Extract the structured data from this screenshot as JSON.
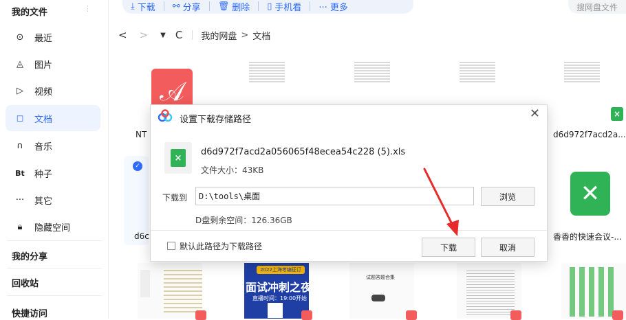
{
  "sidebar": {
    "my_files": "我的文件",
    "items": [
      {
        "icon": "clock-icon",
        "glyph": "⊙",
        "label": "最近"
      },
      {
        "icon": "image-icon",
        "glyph": "◬",
        "label": "图片"
      },
      {
        "icon": "video-icon",
        "glyph": "▷",
        "label": "视频"
      },
      {
        "icon": "document-icon",
        "glyph": "◻",
        "label": "文档"
      },
      {
        "icon": "music-icon",
        "glyph": "∩",
        "label": "音乐"
      },
      {
        "icon": "bt-icon",
        "glyph": "Bt",
        "label": "种子"
      },
      {
        "icon": "more-icon",
        "glyph": "···",
        "label": "其它"
      },
      {
        "icon": "lock-icon",
        "glyph": "🔒︎",
        "label": "隐藏空间"
      }
    ],
    "active_index": 3,
    "my_share": "我的分享",
    "recycle_bin": "回收站",
    "quick_access": "快捷访问"
  },
  "toolbar": {
    "download": "下载",
    "share": "分享",
    "delete": "删除",
    "phone_view": "手机看",
    "more": "··· 更多"
  },
  "search": {
    "placeholder": "搜网盘文件"
  },
  "breadcrumb": {
    "root": "我的网盘",
    "separator": ">",
    "current": "文档"
  },
  "files": {
    "pdf_name_fragment": "NT",
    "selected_name_fragment": "d6c",
    "right_top_name": "d6d972f7acd2a...",
    "right_bottom_name": "香香的快速会议-...",
    "thumb_texts": {
      "notice_title": "面试冲刺之夜",
      "notice_time": "直播时间：19:00开始",
      "notice_banner": "2022上海考编征订",
      "doc_title": "试题答题合集"
    }
  },
  "dialog": {
    "title": "设置下载存储路径",
    "file_name": "d6d972f7acd2a056065f48ecea54c228 (5).xls",
    "file_size": "文件大小：43KB",
    "download_to_label": "下载到",
    "path_value": "D:\\tools\\桌面",
    "browse": "浏览",
    "free_space": "D盘剩余空间：126.36GB",
    "default_path_label": "默认此路径为下载路径",
    "download_button": "下载",
    "cancel_button": "取消"
  },
  "colors": {
    "accent": "#2f6bff",
    "pdf": "#f25c5c",
    "xls": "#2fb356",
    "arrow": "#e52b2b"
  }
}
